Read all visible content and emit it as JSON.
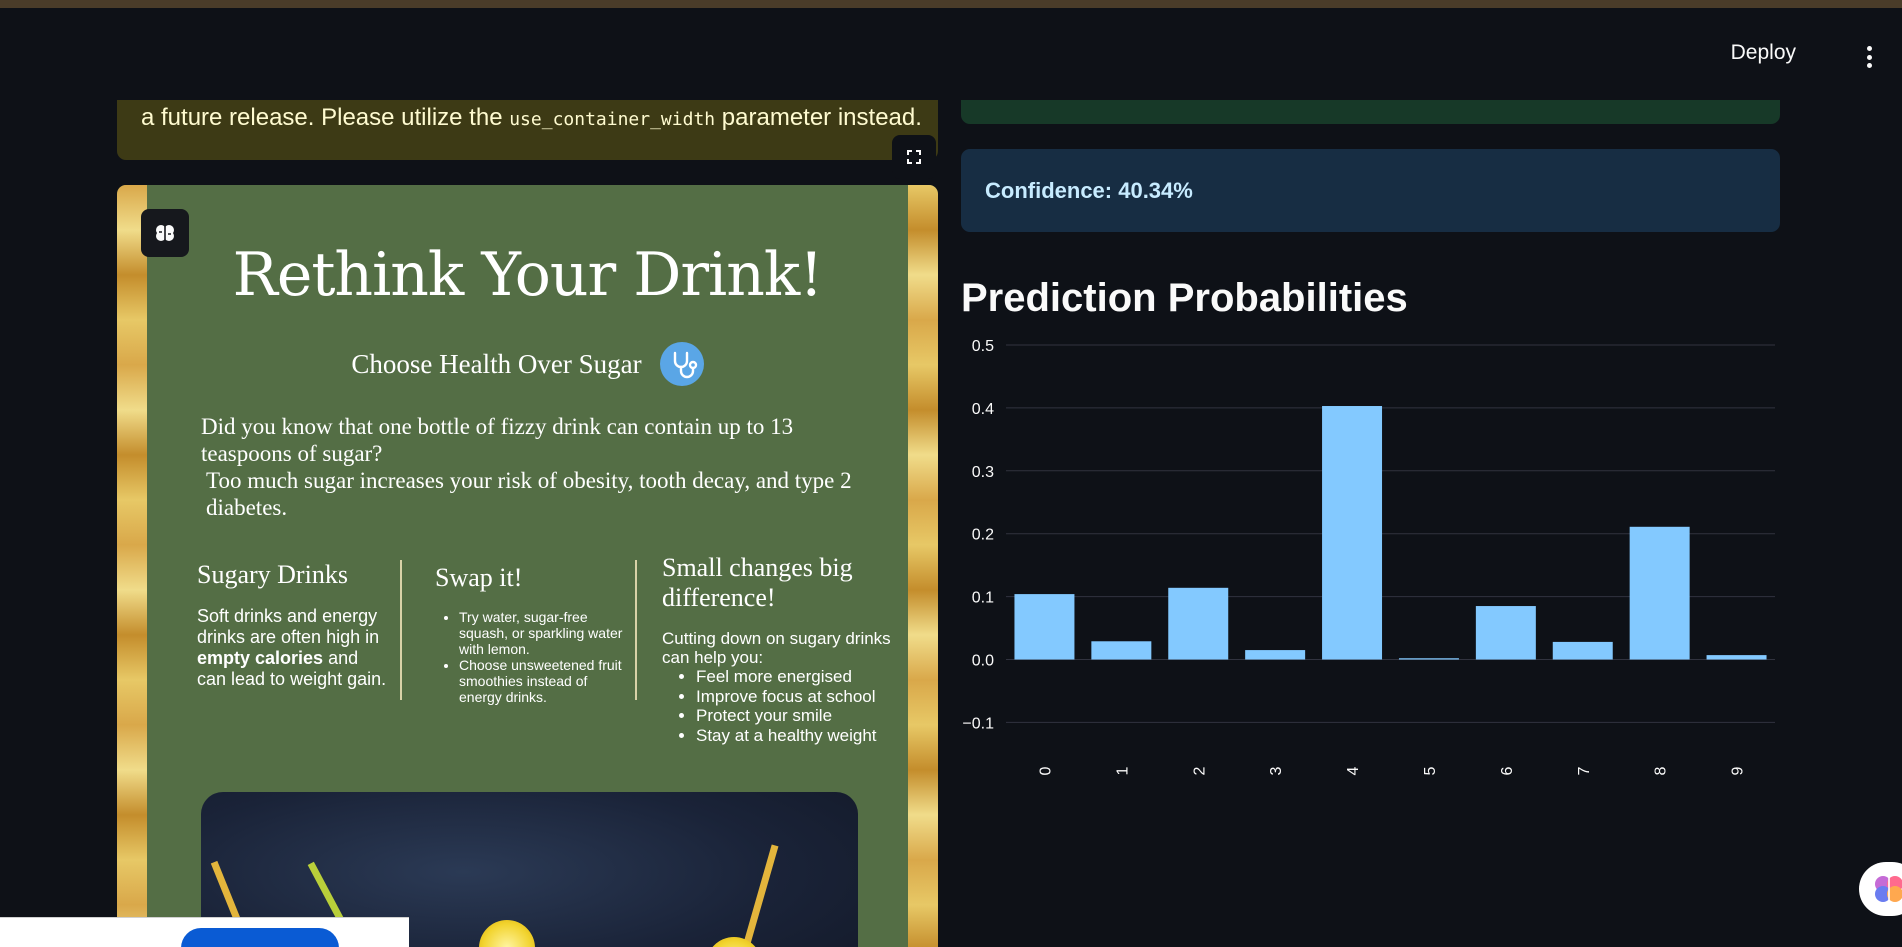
{
  "header": {
    "deploy_label": "Deploy",
    "menu_icon": "kebab-menu-icon"
  },
  "warning": {
    "text_before": "a future release. Please utilize the ",
    "code": "use_container_width",
    "text_after": " parameter instead.",
    "color": "#3d3a15"
  },
  "expand_icon": "fullscreen-icon",
  "poster": {
    "title": "Rethink Your Drink!",
    "subtitle": "Choose Health Over Sugar",
    "intro_line1": "Did you know that one bottle of fizzy drink can contain up to 13",
    "intro_line2": "teaspoons of sugar?",
    "intro_line3": "Too much sugar increases your risk of obesity, tooth decay, and type 2 diabetes.",
    "col1": {
      "heading": "Sugary Drinks",
      "text_a": "Soft drinks and energy drinks are often high in ",
      "bold1": "empty calories",
      "text_b": " and can lead to weight gain."
    },
    "col2": {
      "heading": "Swap it!",
      "items": [
        "Try water, sugar-free squash, or sparkling water with lemon.",
        "Choose unsweetened fruit smoothies instead of energy drinks."
      ]
    },
    "col3": {
      "heading": "Small changes big difference!",
      "intro": "Cutting down on sugary drinks can help you:",
      "items": [
        "Feel more energised",
        "Improve focus at school",
        " Protect your smile",
        "Stay at a healthy weight"
      ]
    }
  },
  "confidence": {
    "text": "Confidence: 40.34%",
    "bg": "#172d43",
    "fg": "#c7ebff"
  },
  "success_bg": "#173928",
  "chart_heading": "Prediction Probabilities",
  "chart_data": {
    "type": "bar",
    "categories": [
      "0",
      "1",
      "2",
      "3",
      "4",
      "5",
      "6",
      "7",
      "8",
      "9"
    ],
    "values": [
      0.104,
      0.029,
      0.114,
      0.015,
      0.403,
      0.002,
      0.085,
      0.028,
      0.211,
      0.007
    ],
    "ylim": [
      -0.12,
      0.5
    ],
    "yticks": [
      "0.5",
      "0.4",
      "0.3",
      "0.2",
      "0.1",
      "0.0",
      "−0.1"
    ],
    "ytick_values": [
      0.5,
      0.4,
      0.3,
      0.2,
      0.1,
      0.0,
      -0.1
    ],
    "bar_color": "#83c9ff",
    "grid": true
  }
}
